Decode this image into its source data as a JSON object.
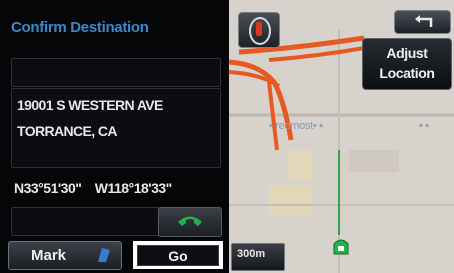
{
  "left_panel": {
    "title": "Confirm Destination",
    "name_value": "",
    "address_line1": "19001 S WESTERN AVE",
    "address_line2": "TORRANCE, CA",
    "latitude": "N33°51'30\"",
    "longitude": "W118°18'33\"",
    "phone_value": ""
  },
  "buttons": {
    "mark_label": "Mark",
    "go_label": "Go",
    "call_icon": "phone-icon",
    "mark_icon": "flag-icon"
  },
  "map": {
    "adjust_line1": "Adjust",
    "adjust_line2": "Location",
    "street_label": "• redmost• ▪",
    "street_label_right": "• •",
    "scale_label": "300m",
    "compass_icon": "compass-icon",
    "back_icon": "back-arrow-icon",
    "destination_icon": "destination-pin-icon",
    "road_color": "#e65a22",
    "map_bg_color": "#d7d3cc"
  },
  "colors": {
    "title_blue": "#3f88c8",
    "text": "#e8e8e8",
    "call_green": "#25b24a"
  }
}
